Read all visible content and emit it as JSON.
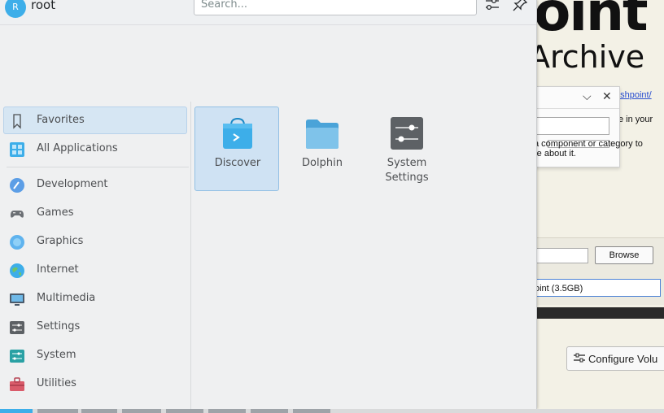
{
  "launcher": {
    "user": {
      "avatar_letter": "R",
      "name": "root"
    },
    "search": {
      "placeholder": "Search...",
      "value": ""
    },
    "header_buttons": [
      {
        "name": "configure",
        "icon": "sliders-icon"
      },
      {
        "name": "pin",
        "icon": "pin-icon"
      }
    ],
    "sidebar": {
      "items": [
        {
          "label": "Favorites",
          "icon": "bookmark-icon",
          "active": true
        },
        {
          "label": "All Applications",
          "icon": "grid-apps-icon",
          "active": false
        },
        {
          "label": "Development",
          "icon": "development-icon",
          "active": false
        },
        {
          "label": "Games",
          "icon": "gamepad-icon",
          "active": false
        },
        {
          "label": "Graphics",
          "icon": "graphics-icon",
          "active": false
        },
        {
          "label": "Internet",
          "icon": "globe-icon",
          "active": false
        },
        {
          "label": "Multimedia",
          "icon": "multimedia-icon",
          "active": false
        },
        {
          "label": "Settings",
          "icon": "settings-icon",
          "active": false
        },
        {
          "label": "System",
          "icon": "system-icon",
          "active": false
        },
        {
          "label": "Utilities",
          "icon": "toolbox-icon",
          "active": false
        }
      ]
    },
    "favorites": [
      {
        "label": "Discover",
        "icon": "discover-bag-icon",
        "active": true
      },
      {
        "label": "Dolphin",
        "icon": "folder-icon",
        "active": false
      },
      {
        "label": "System Settings",
        "icon": "system-settings-icon",
        "active": false
      }
    ]
  },
  "background_app": {
    "logo_line1": "oint",
    "logo_line2": "Archive",
    "dialog": {
      "link_text": "ashpoint/",
      "text1": "e in your",
      "text2": "",
      "text3": "a component or category to",
      "text4": "re about it."
    },
    "browse_label": "Browse",
    "selected_option": "oint (3.5GB)",
    "configure_label": "Configure Volu"
  },
  "colors": {
    "accent": "#3daee9",
    "selection_bg": "#cfe2f3",
    "panel_bg": "#eff0f1"
  }
}
